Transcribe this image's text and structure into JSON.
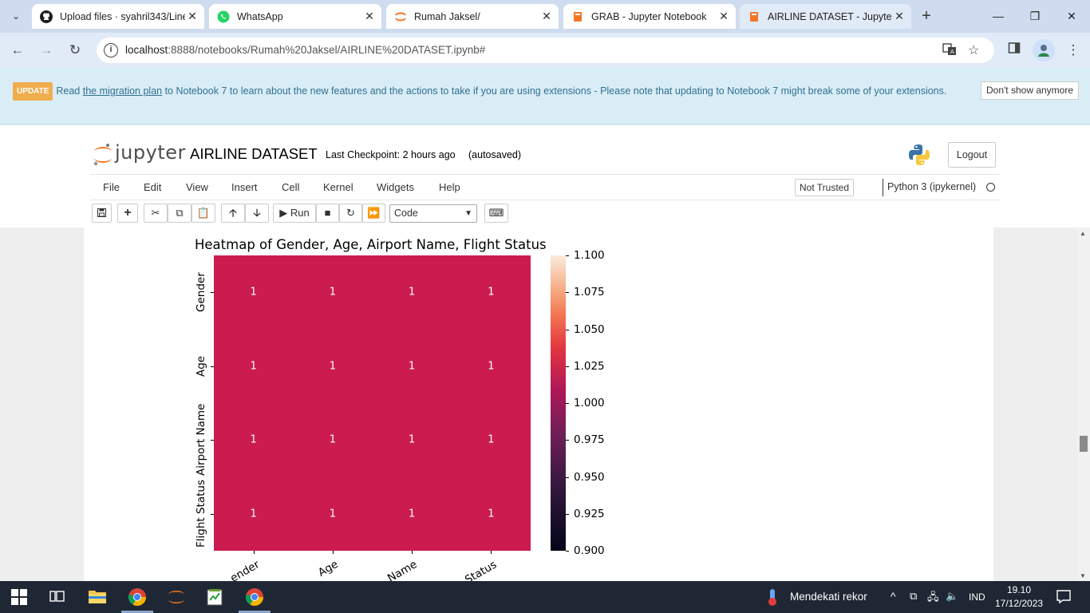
{
  "browser": {
    "tabs": [
      {
        "title": "Upload files · syahril343/Line",
        "icon": "github-icon",
        "active": false
      },
      {
        "title": "WhatsApp",
        "icon": "whatsapp-icon",
        "active": false
      },
      {
        "title": "Rumah Jaksel/",
        "icon": "jupyter-icon",
        "active": false
      },
      {
        "title": "GRAB - Jupyter Notebook",
        "icon": "notebook-icon",
        "active": false
      },
      {
        "title": "AIRLINE DATASET - Jupyter N",
        "icon": "notebook-icon",
        "active": true
      }
    ],
    "url_host": "localhost",
    "url_path": ":8888/notebooks/Rumah%20Jaksel/AIRLINE%20DATASET.ipynb#"
  },
  "notice": {
    "badge": "UPDATE",
    "before_link": "Read ",
    "link": "the migration plan",
    "after_link": " to Notebook 7 to learn about the new features and the actions to take if you are using extensions - Please note that updating to Notebook 7 might break some of your extensions.",
    "dismiss": "Don't show anymore"
  },
  "jupyter": {
    "logo_text": "jupyter",
    "notebook_name": "AIRLINE DATASET",
    "checkpoint": "Last Checkpoint: 2 hours ago",
    "autosave": "(autosaved)",
    "logout": "Logout",
    "menu": [
      "File",
      "Edit",
      "View",
      "Insert",
      "Cell",
      "Kernel",
      "Widgets",
      "Help"
    ],
    "trusted": "Not Trusted",
    "kernel": "Python 3 (ipykernel)",
    "run_label": "Run",
    "cell_type": "Code"
  },
  "chart_data": {
    "type": "heatmap",
    "title": "Heatmap of Gender, Age, Airport Name, Flight Status",
    "rows": [
      "Gender",
      "Age",
      "Airport Name",
      "Flight Status"
    ],
    "columns_visible_text": [
      "ender",
      "Age",
      "Name",
      "Status"
    ],
    "values": [
      [
        1,
        1,
        1,
        1
      ],
      [
        1,
        1,
        1,
        1
      ],
      [
        1,
        1,
        1,
        1
      ],
      [
        1,
        1,
        1,
        1
      ]
    ],
    "annotations": true,
    "colorbar": {
      "ticks": [
        "1.100",
        "1.075",
        "1.050",
        "1.025",
        "1.000",
        "0.975",
        "0.950",
        "0.925",
        "0.900"
      ],
      "range": [
        0.9,
        1.1
      ],
      "colormap": "rocket"
    },
    "cell_color": "#cb1b4f"
  },
  "taskbar": {
    "weather": "Mendekati rekor",
    "lang": "IND",
    "time": "19.10",
    "date": "17/12/2023"
  }
}
